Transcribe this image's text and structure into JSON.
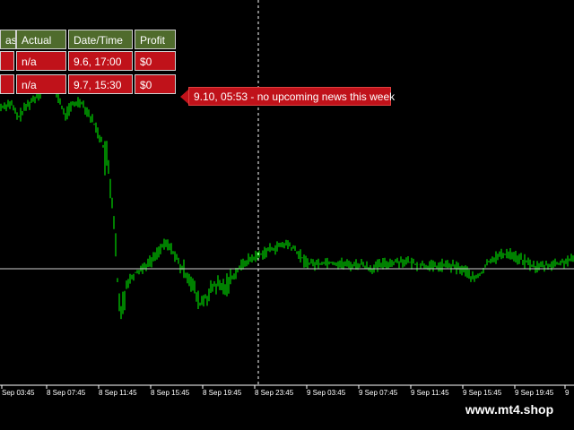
{
  "news_table": {
    "headers": [
      "ast",
      "Actual",
      "Date/Time",
      "Profit"
    ],
    "rows": [
      [
        "",
        "n/a",
        "9.6, 17:00",
        "$0"
      ],
      [
        "",
        "n/a",
        "9.7, 15:30",
        "$0"
      ]
    ]
  },
  "tooltip": {
    "text": "9.10, 05:53 - no upcoming news this week"
  },
  "time_axis": {
    "labels": [
      "Sep 03:45",
      "8 Sep 07:45",
      "8 Sep 11:45",
      "8 Sep 15:45",
      "8 Sep 19:45",
      "8 Sep 23:45",
      "9 Sep 03:45",
      "9 Sep 07:45",
      "9 Sep 11:45",
      "9 Sep 15:45",
      "9 Sep 19:45",
      "9"
    ]
  },
  "watermark": "www.mt4.shop",
  "colors": {
    "background": "#000000",
    "candles": "#00ff00",
    "table_header": "#4f6b2c",
    "table_row": "#c0121a",
    "grid": "#ffffff"
  }
}
